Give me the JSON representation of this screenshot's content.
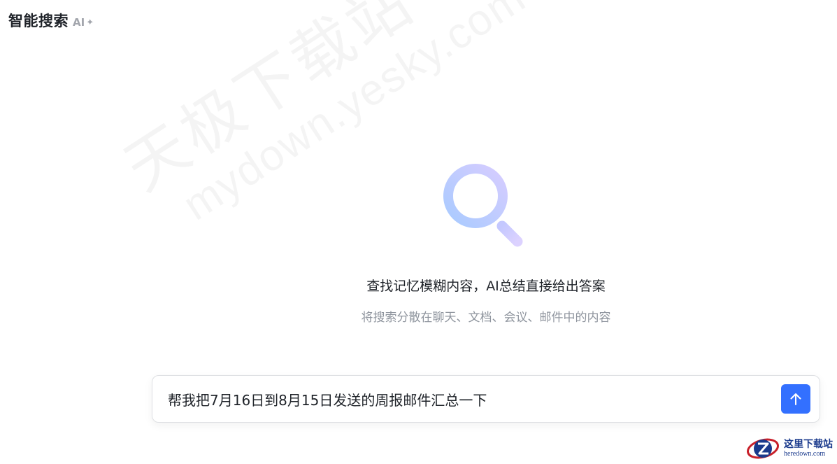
{
  "header": {
    "title": "智能搜索",
    "ai_badge": "AI"
  },
  "watermark": {
    "cn": "天极下载站",
    "en": "mydown.yesky.com"
  },
  "empty_state": {
    "title": "查找记忆模糊内容，AI总结直接给出答案",
    "subtitle": "将搜索分散在聊天、文档、会议、邮件中的内容"
  },
  "composer": {
    "value": "帮我把7月16日到8月15日发送的周报邮件汇总一下",
    "send_icon": "arrow-up-icon"
  },
  "corner_logo": {
    "cn": "这里下载站",
    "en": "heredown.com"
  },
  "colors": {
    "accent": "#3370ff",
    "title": "#1f2329",
    "subtitle": "#8f959e"
  }
}
